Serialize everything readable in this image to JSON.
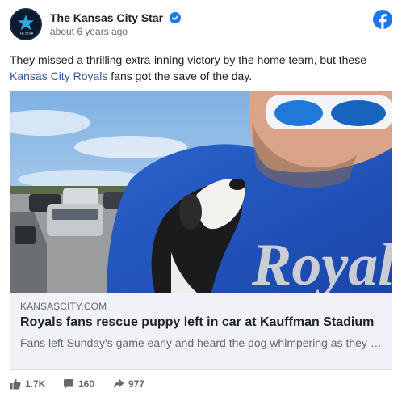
{
  "page": {
    "name": "The Kansas City Star",
    "timestamp": "about 6 years ago",
    "avatar_text": "THE STAR"
  },
  "post": {
    "text_before": "They missed a thrilling extra-inning victory by the home team, but these ",
    "link_text": "Kansas City Royals",
    "text_after": " fans got the save of the day."
  },
  "link_card": {
    "domain": "KANSASCITY.COM",
    "title": "Royals fans rescue puppy left in car at Kauffman Stadium",
    "description": "Fans left Sunday's game early and heard the dog whimpering as they …"
  },
  "stats": {
    "likes": "1.7K",
    "comments": "160",
    "shares": "977"
  },
  "image": {
    "jersey_lettering": "Royals"
  },
  "colors": {
    "facebook_blue": "#1877f2",
    "link": "#385898",
    "jersey": "#1f4fb5"
  },
  "icons": {
    "verified": "verified-badge-icon",
    "facebook": "facebook-logo-icon",
    "like": "thumbs-up-icon",
    "comment": "comment-icon",
    "share": "share-arrow-icon"
  }
}
